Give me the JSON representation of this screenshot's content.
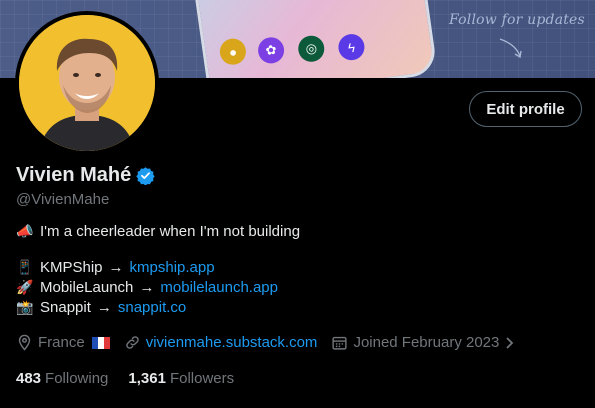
{
  "banner": {
    "follow_text": "Follow for updates",
    "apps": [
      {
        "icon": "lotus-icon",
        "color": "#7b3fe4"
      },
      {
        "icon": "circle-icon",
        "color": "#0c5a3a"
      },
      {
        "icon": "bolt-icon",
        "color": "#5a3ae6"
      },
      {
        "icon": "toggle-icon",
        "color": "#d9a51a"
      }
    ]
  },
  "profile": {
    "name": "Vivien Mahé",
    "handle": "@VivienMahe",
    "edit_button": "Edit profile",
    "verified_color": "#1d9bf0"
  },
  "bio": {
    "line1_emoji": "📣",
    "line1": "I'm a cheerleader when I'm not building",
    "projects": [
      {
        "emoji": "📱",
        "name": "KMPShip",
        "arrow": "→",
        "link": "kmpship.app"
      },
      {
        "emoji": "🚀",
        "name": "MobileLaunch",
        "arrow": "→",
        "link": "mobilelaunch.app"
      },
      {
        "emoji": "📸",
        "name": "Snappit",
        "arrow": "→",
        "link": "snappit.co"
      }
    ]
  },
  "meta": {
    "location": "France",
    "website": "vivienmahe.substack.com",
    "joined": "Joined February 2023"
  },
  "stats": {
    "following_count": "483",
    "following_label": "Following",
    "followers_count": "1,361",
    "followers_label": "Followers"
  },
  "colors": {
    "accent": "#1d9bf0",
    "muted": "#71767b",
    "text": "#e7e9ea",
    "background": "#000000"
  }
}
